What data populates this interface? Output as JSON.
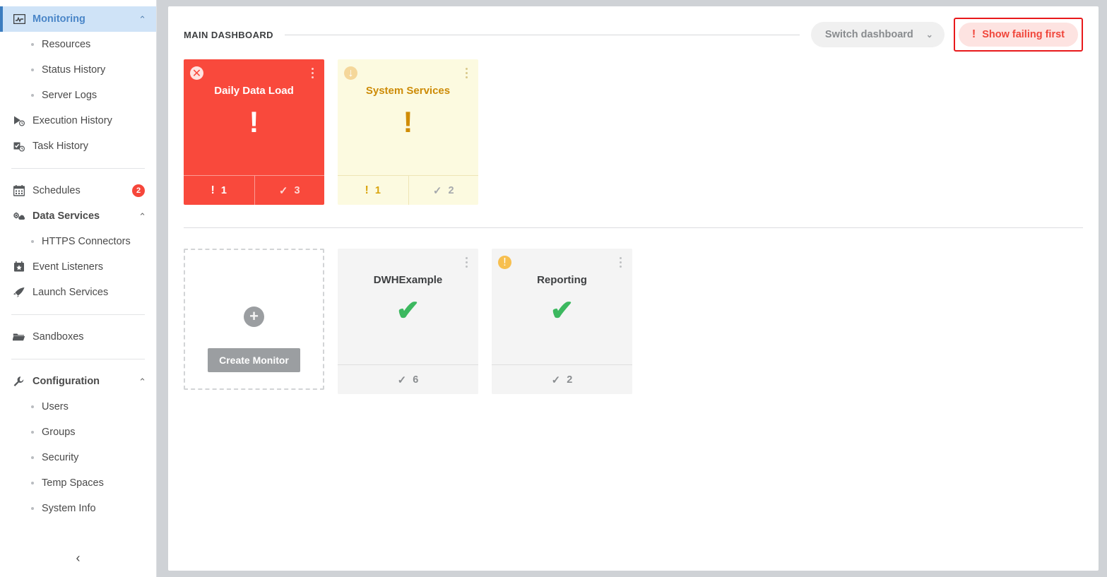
{
  "sidebar": {
    "nav": [
      {
        "id": "monitoring",
        "label": "Monitoring",
        "icon": "monitor-icon",
        "type": "group",
        "active": true,
        "expanded": true,
        "chevron": "⌃"
      },
      {
        "id": "resources",
        "label": "Resources",
        "type": "sub"
      },
      {
        "id": "status-history",
        "label": "Status History",
        "type": "sub"
      },
      {
        "id": "server-logs",
        "label": "Server Logs",
        "type": "sub"
      },
      {
        "id": "execution-history",
        "label": "Execution History",
        "icon": "play-clock-icon",
        "type": "item"
      },
      {
        "id": "task-history",
        "label": "Task History",
        "icon": "task-clock-icon",
        "type": "item"
      },
      {
        "id": "separator-1",
        "type": "separator"
      },
      {
        "id": "schedules",
        "label": "Schedules",
        "icon": "calendar-icon",
        "type": "item",
        "badge": "2"
      },
      {
        "id": "data-services",
        "label": "Data Services",
        "icon": "gear-cloud-icon",
        "type": "group",
        "expanded": true,
        "chevron": "⌃"
      },
      {
        "id": "https-connectors",
        "label": "HTTPS Connectors",
        "type": "sub"
      },
      {
        "id": "event-listeners",
        "label": "Event Listeners",
        "icon": "calendar-star-icon",
        "type": "item"
      },
      {
        "id": "launch-services",
        "label": "Launch Services",
        "icon": "rocket-icon",
        "type": "item"
      },
      {
        "id": "separator-2",
        "type": "separator"
      },
      {
        "id": "sandboxes",
        "label": "Sandboxes",
        "icon": "folder-icon",
        "type": "item"
      },
      {
        "id": "separator-3",
        "type": "separator"
      },
      {
        "id": "configuration",
        "label": "Configuration",
        "icon": "wrench-icon",
        "type": "group",
        "expanded": true,
        "chevron": "⌃"
      },
      {
        "id": "users",
        "label": "Users",
        "type": "sub"
      },
      {
        "id": "groups",
        "label": "Groups",
        "type": "sub"
      },
      {
        "id": "security",
        "label": "Security",
        "type": "sub"
      },
      {
        "id": "temp-spaces",
        "label": "Temp Spaces",
        "type": "sub"
      },
      {
        "id": "system-info",
        "label": "System Info",
        "type": "sub"
      }
    ],
    "collapse_glyph": "‹",
    "collapse_name": "collapse-sidebar-button"
  },
  "header": {
    "title": "MAIN DASHBOARD",
    "switch_dashboard_label": "Switch dashboard",
    "switch_dashboard_caret": "⌄",
    "show_failing_label": "Show failing first",
    "show_failing_bang": "!",
    "highlight_color": "#e8191b"
  },
  "colors": {
    "error": "#f9493c",
    "warning": "#d08c06",
    "warning_bg": "#fcfae0",
    "ok_bg": "#f4f4f4",
    "success": "#3cb85f",
    "badge_red": "#f6463a",
    "accent_blue": "#4a86c8"
  },
  "monitors": {
    "row1": [
      {
        "id": "daily-data-load",
        "name": "Daily Data Load",
        "state": "err",
        "badge_icon": "circle-x-icon",
        "badge_glyph": "✕",
        "mark": "!",
        "footer": [
          {
            "icon": "exclamation-icon",
            "glyph": "!",
            "count": "1",
            "kind": "fail"
          },
          {
            "icon": "check-icon",
            "glyph": "✓",
            "count": "3",
            "kind": "ok"
          }
        ]
      },
      {
        "id": "system-services",
        "name": "System Services",
        "state": "warn",
        "badge_icon": "circle-arrow-down-icon",
        "badge_glyph": "↓",
        "mark": "!",
        "footer": [
          {
            "icon": "exclamation-icon",
            "glyph": "!",
            "count": "1",
            "kind": "fail"
          },
          {
            "icon": "check-icon",
            "glyph": "✓",
            "count": "2",
            "kind": "ok"
          }
        ]
      }
    ],
    "row2_create": {
      "id": "create-monitor",
      "plus_glyph": "+",
      "button_label": "Create Monitor"
    },
    "row2": [
      {
        "id": "dwhexample",
        "name": "DWHExample",
        "state": "ok",
        "badge_icon": null,
        "badge_glyph": "",
        "mark": "✔",
        "footer": [
          {
            "icon": "check-icon",
            "glyph": "✓",
            "count": "6",
            "kind": "ok"
          }
        ]
      },
      {
        "id": "reporting",
        "name": "Reporting",
        "state": "ok",
        "badge_icon": "circle-exclamation-icon",
        "badge_glyph": "!",
        "mark": "✔",
        "footer": [
          {
            "icon": "check-icon",
            "glyph": "✓",
            "count": "2",
            "kind": "ok"
          }
        ]
      }
    ]
  }
}
